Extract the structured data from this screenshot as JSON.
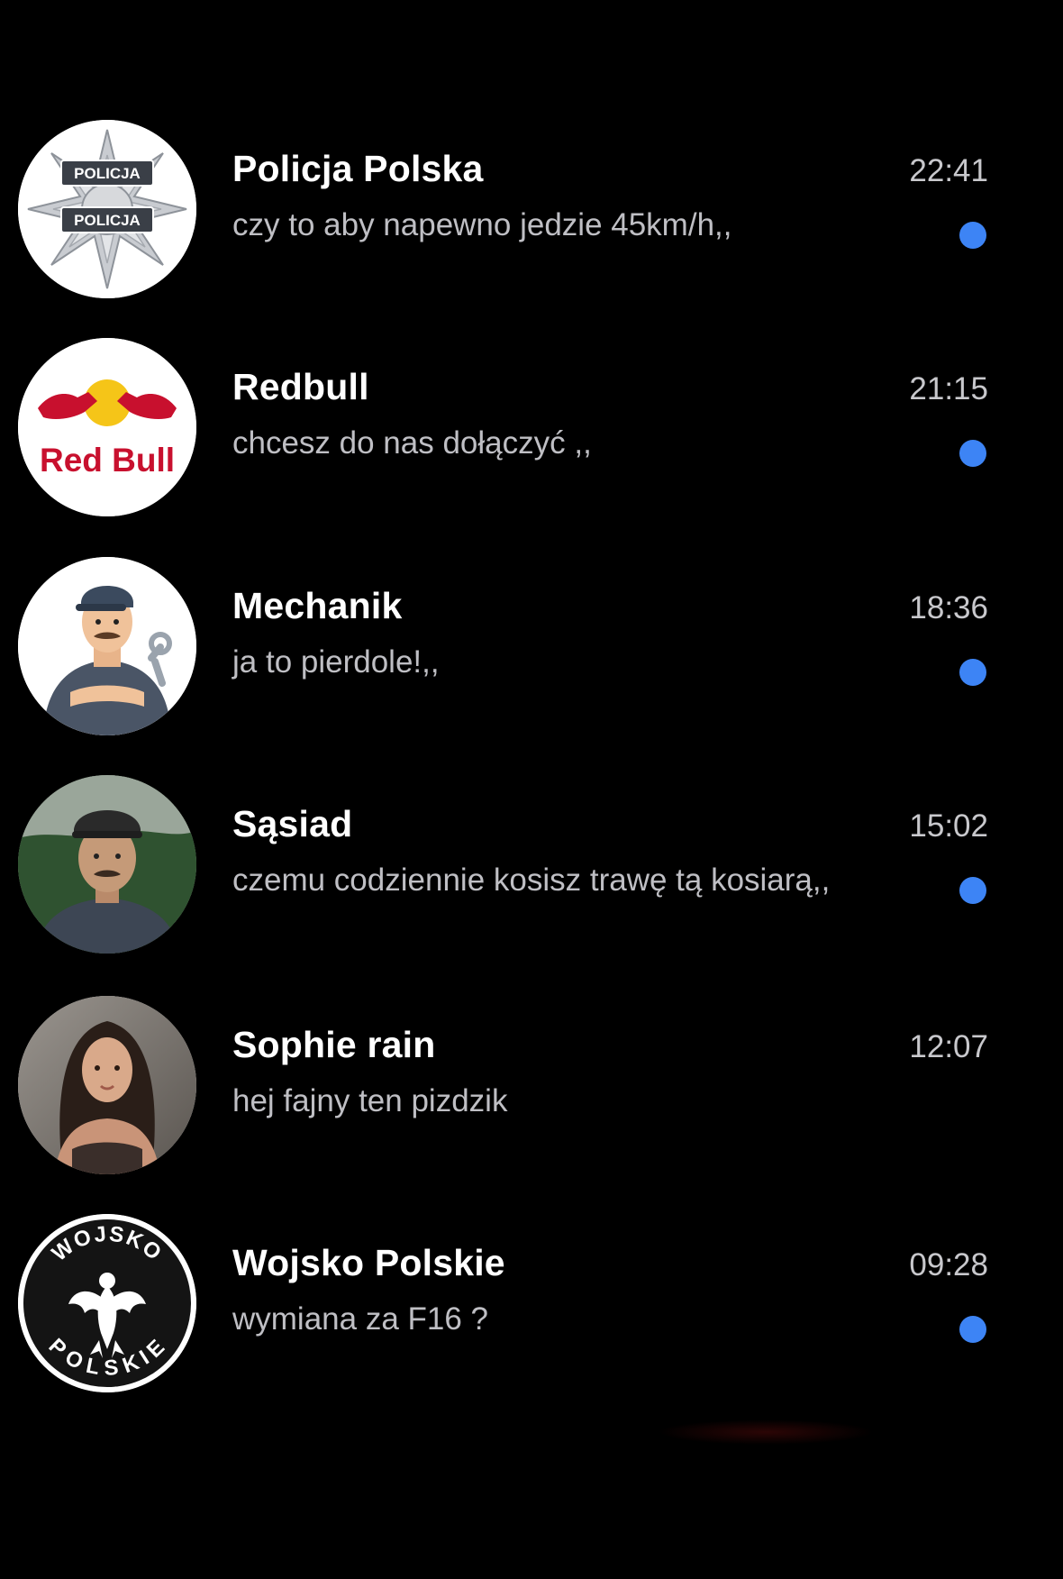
{
  "chats": [
    {
      "name": "Policja Polska",
      "preview": "czy to aby napewno jedzie 45km/h,,",
      "time": "22:41",
      "unread": true,
      "avatar": "police-star-badge"
    },
    {
      "name": "Redbull",
      "preview": "chcesz do nas dołączyć ,,",
      "time": "21:15",
      "unread": true,
      "avatar": "redbull-logo"
    },
    {
      "name": "Mechanik",
      "preview": "ja to pierdole!,,",
      "time": "18:36",
      "unread": true,
      "avatar": "mechanic-cartoon"
    },
    {
      "name": "Sąsiad",
      "preview": "czemu codziennie kosisz trawę tą kosiarą,,",
      "time": "15:02",
      "unread": true,
      "avatar": "neighbor-photo"
    },
    {
      "name": "Sophie rain",
      "preview": "hej fajny ten pizdzik",
      "time": "12:07",
      "unread": false,
      "avatar": "woman-photo"
    },
    {
      "name": "Wojsko Polskie",
      "preview": "wymiana za F16 ?",
      "time": "09:28",
      "unread": true,
      "avatar": "army-eagle-emblem"
    }
  ],
  "logos": {
    "police_top": "POLICJA",
    "police_bottom": "POLICJA",
    "redbull": "Red Bull",
    "army_top": "WOJSKO",
    "army_bottom": "POLSKIE"
  },
  "colors": {
    "background": "#000000",
    "unread_dot": "#3d84f5",
    "preview_text": "#bfbfc4",
    "redbull_red": "#c8102e",
    "redbull_sun": "#f5c518"
  }
}
